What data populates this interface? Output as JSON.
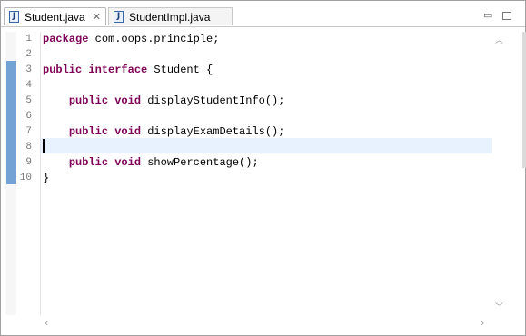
{
  "tabs": [
    {
      "label": "Student.java",
      "icon": "java-file-icon",
      "active": true,
      "close": "✕"
    },
    {
      "label": "StudentImpl.java",
      "icon": "java-file-icon",
      "active": false
    }
  ],
  "window_controls": {
    "minimize": "▭"
  },
  "editor": {
    "lines": [
      {
        "num": "1",
        "pre": "",
        "kw": "package",
        "rest": " com.oops.principle;"
      },
      {
        "num": "2",
        "pre": "",
        "kw": "",
        "rest": ""
      },
      {
        "num": "3",
        "pre": "",
        "kw": "public interface",
        "rest": " Student {"
      },
      {
        "num": "4",
        "pre": "",
        "kw": "",
        "rest": ""
      },
      {
        "num": "5",
        "pre": "    ",
        "kw": "public void",
        "rest": " displayStudentInfo();"
      },
      {
        "num": "6",
        "pre": "",
        "kw": "",
        "rest": ""
      },
      {
        "num": "7",
        "pre": "    ",
        "kw": "public void",
        "rest": " displayExamDetails();"
      },
      {
        "num": "8",
        "pre": "",
        "kw": "",
        "rest": ""
      },
      {
        "num": "9",
        "pre": "    ",
        "kw": "public void",
        "rest": " showPercentage();"
      },
      {
        "num": "10",
        "pre": "",
        "kw": "",
        "rest": "}"
      }
    ]
  },
  "colors": {
    "keyword": "#7f0055",
    "current_line": "#e8f2fe",
    "change_ruler": "#4a86c8"
  }
}
